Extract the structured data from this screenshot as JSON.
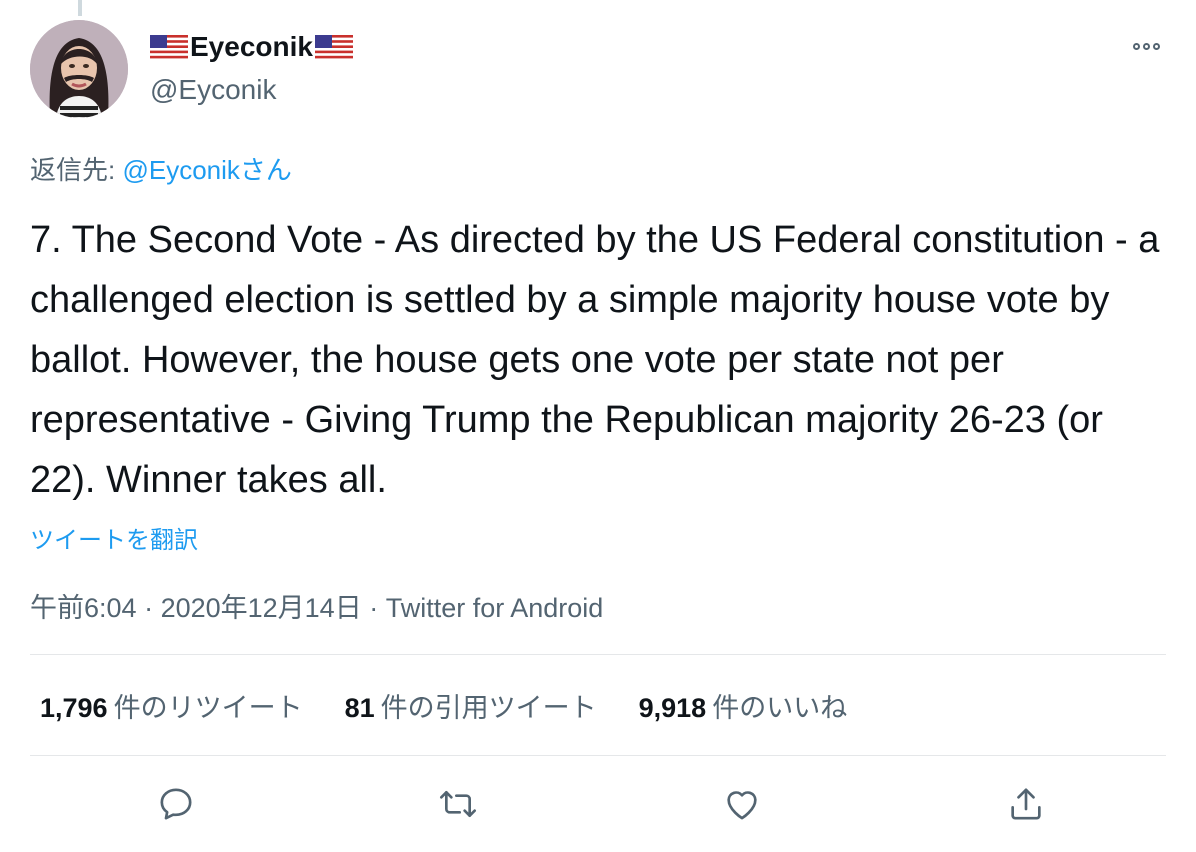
{
  "user": {
    "display_name": "Eyeconik",
    "handle": "@Eyconik",
    "flag_icon": "us-flag-icon"
  },
  "reply": {
    "prefix": "返信先: ",
    "target": "@Eyconikさん"
  },
  "tweet": {
    "text": "7. The Second Vote - As directed by the US Federal constitution - a challenged election is settled by a simple majority house vote by ballot. However, the house gets one vote per state not per representative - Giving Trump the Republican majority 26-23 (or 22). Winner takes all."
  },
  "translate_label": "ツイートを翻訳",
  "meta": {
    "time": "午前6:04",
    "separator1": " · ",
    "date": "2020年12月14日",
    "separator2": " · ",
    "source": "Twitter for Android"
  },
  "stats": {
    "retweets_count": "1,796",
    "retweets_label": "件のリツイート",
    "quotes_count": "81",
    "quotes_label": "件の引用ツイート",
    "likes_count": "9,918",
    "likes_label": "件のいいね"
  },
  "actions": [
    "reply-icon",
    "retweet-icon",
    "like-icon",
    "share-icon"
  ],
  "colors": {
    "link": "#1d9bf0",
    "secondary_text": "#536471",
    "primary_text": "#0f1419"
  }
}
